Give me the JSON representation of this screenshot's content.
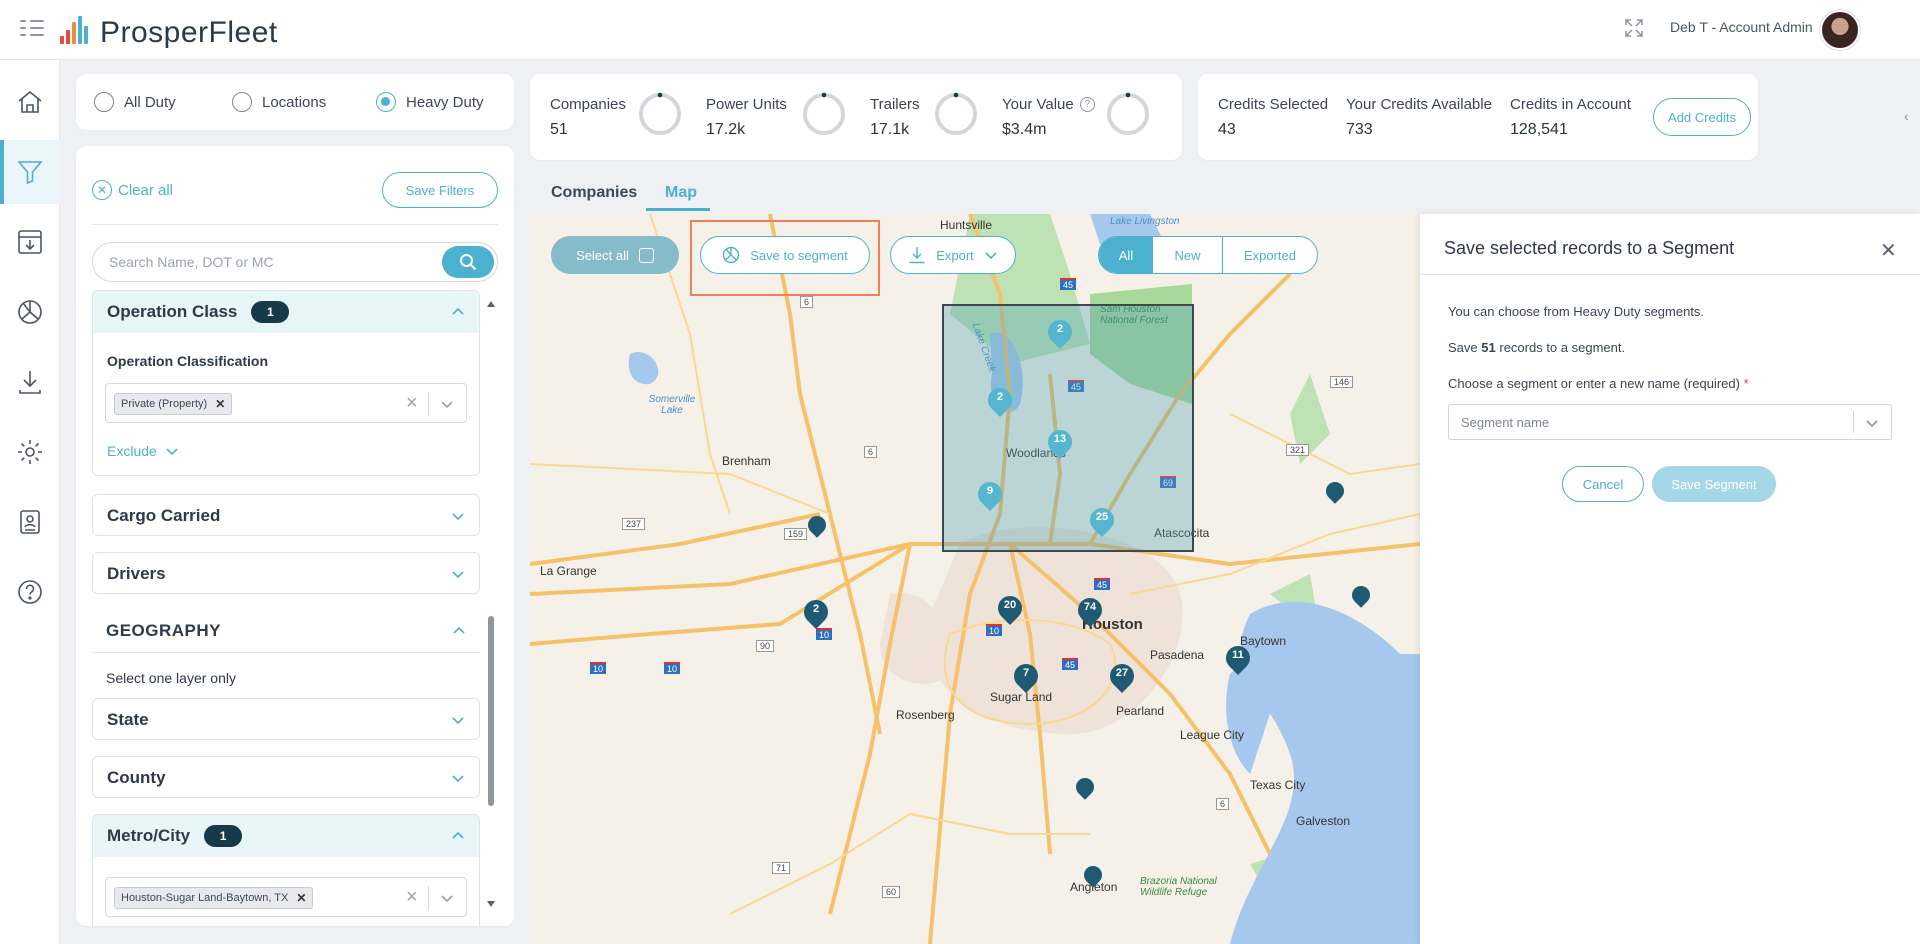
{
  "app": {
    "name": "ProsperFleet",
    "user": "Deb T - Account Admin"
  },
  "colors": {
    "accent": "#4cb1cf",
    "dark": "#163a4a",
    "highlight": "#f07f5a"
  },
  "duty": {
    "options": [
      "All Duty",
      "Locations",
      "Heavy Duty"
    ],
    "selected": "Heavy Duty"
  },
  "filters": {
    "clear_all": "Clear all",
    "save_filters": "Save Filters",
    "search_placeholder": "Search Name, DOT or MC",
    "operation_class": {
      "title": "Operation Class",
      "count": "1",
      "sub_label": "Operation Classification",
      "chip": "Private (Property)",
      "exclude": "Exclude"
    },
    "cargo_carried": "Cargo Carried",
    "drivers": "Drivers",
    "geography": {
      "title": "GEOGRAPHY",
      "hint": "Select one layer only"
    },
    "state": "State",
    "county": "County",
    "metro_city": {
      "title": "Metro/City",
      "count": "1",
      "chip": "Houston-Sugar Land-Baytown, TX"
    }
  },
  "stats": {
    "companies": {
      "label": "Companies",
      "value": "51"
    },
    "power_units": {
      "label": "Power Units",
      "value": "17.2k"
    },
    "trailers": {
      "label": "Trailers",
      "value": "17.1k"
    },
    "your_value": {
      "label": "Your Value",
      "value": "$3.4m"
    }
  },
  "credits": {
    "selected": {
      "label": "Credits Selected",
      "value": "43"
    },
    "available": {
      "label": "Your Credits Available",
      "value": "733"
    },
    "in_account": {
      "label": "Credits in Account",
      "value": "128,541"
    },
    "add_button": "Add Credits"
  },
  "tabs": [
    "Companies",
    "Map"
  ],
  "active_tab": "Map",
  "map": {
    "select_all": "Select all",
    "save_to_segment": "Save to segment",
    "export": "Export",
    "filter_options": [
      "All",
      "New",
      "Exported"
    ],
    "filter_selected": "All",
    "labels": {
      "huntsville": "Huntsville",
      "lake_livingston": "Lake Livingston",
      "sam_houston_nf": "Sam Houston National Forest",
      "lake_creek": "Lake Creek",
      "somerville_lake": "Somerville Lake",
      "brenham": "Brenham",
      "la_grange": "La Grange",
      "woodlands": "Woodlands",
      "atascocita": "Atascocita",
      "houston": "Houston",
      "pasadena": "Pasadena",
      "baytown": "Baytown",
      "sugar_land": "Sugar Land",
      "rosenberg": "Rosenberg",
      "pearland": "Pearland",
      "league_city": "League City",
      "texas_city": "Texas City",
      "galveston": "Galveston",
      "angleton": "Angleton",
      "brazoria_nwr": "Brazoria National Wildlife Refuge",
      "hw_6a": "6",
      "hw_6b": "6",
      "hw_237": "237",
      "hw_159": "159",
      "hw_90": "90",
      "hw_71": "71",
      "hw_60": "60",
      "hw_146": "146",
      "hw_321": "321",
      "hw_6c": "6",
      "i45a": "45",
      "i45b": "45",
      "i45c": "45",
      "i45d": "45",
      "i69": "69",
      "i10a": "10",
      "i10b": "10",
      "i10c": "10",
      "i10d": "10",
      "i69b": "69"
    },
    "markers": [
      {
        "label": "2",
        "tone": "light"
      },
      {
        "label": "2",
        "tone": "light"
      },
      {
        "label": "13",
        "tone": "light"
      },
      {
        "label": "9",
        "tone": "light"
      },
      {
        "label": "25",
        "tone": "light"
      },
      {
        "label": "20",
        "tone": "dark"
      },
      {
        "label": "74",
        "tone": "dark"
      },
      {
        "label": "2",
        "tone": "dark"
      },
      {
        "label": "7",
        "tone": "dark"
      },
      {
        "label": "27",
        "tone": "dark"
      },
      {
        "label": "11",
        "tone": "dark"
      },
      {
        "label": "",
        "tone": "dark"
      },
      {
        "label": "",
        "tone": "dark"
      },
      {
        "label": "",
        "tone": "dark"
      },
      {
        "label": "",
        "tone": "dark"
      },
      {
        "label": "",
        "tone": "dark"
      }
    ]
  },
  "segment_panel": {
    "title": "Save selected records to a Segment",
    "line1": "You can choose from Heavy Duty segments.",
    "line2_prefix": "Save",
    "line2_count": "51",
    "line2_suffix": "records to a segment.",
    "field_label": "Choose a segment or enter a new name (required)",
    "required_mark": "*",
    "placeholder": "Segment name",
    "cancel": "Cancel",
    "save": "Save Segment"
  }
}
